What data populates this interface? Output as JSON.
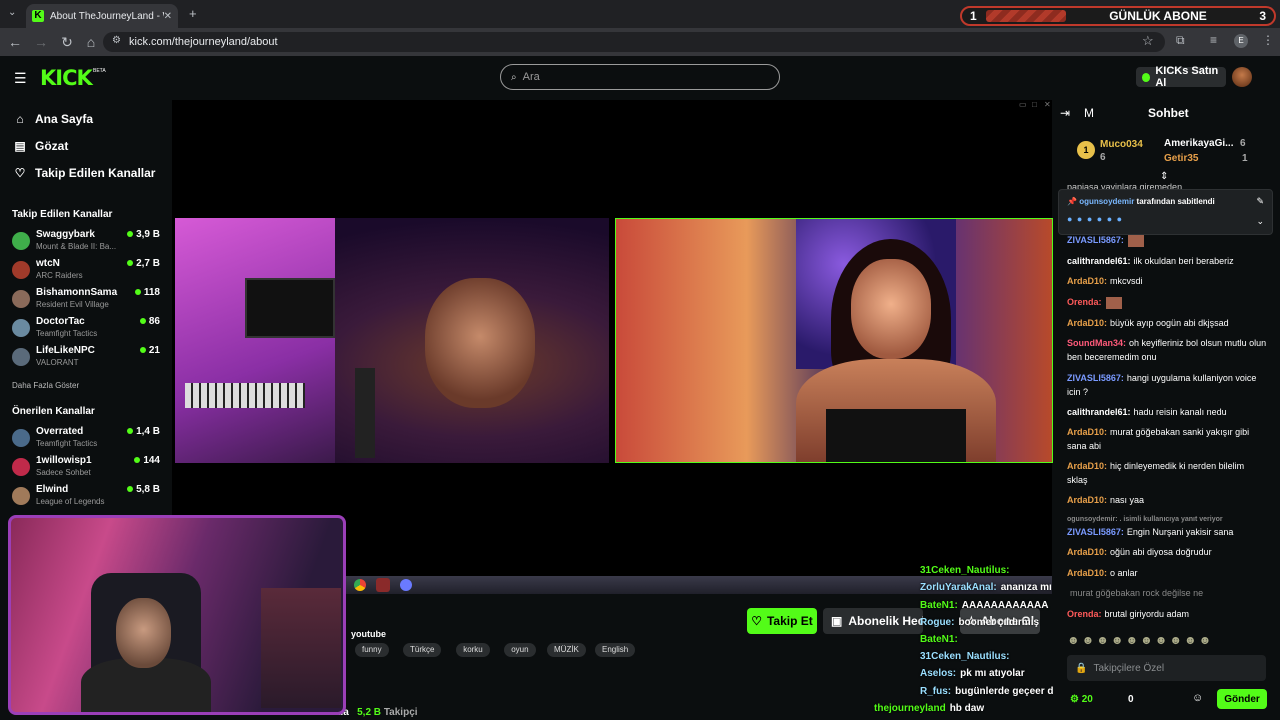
{
  "browser": {
    "tab_title": "About TheJourneyLand - W",
    "url": "kick.com/thejourneyland/about"
  },
  "sub_goal": {
    "left": "1",
    "label": "GÜNLÜK ABONE",
    "right": "3"
  },
  "header": {
    "logo": "KICK",
    "beta": "BETA",
    "search_placeholder": "Ara",
    "kicks_button": "KICKs Satın Al"
  },
  "sidebar": {
    "nav": [
      {
        "label": "Ana Sayfa",
        "icon": "home-icon"
      },
      {
        "label": "Gözat",
        "icon": "browse-icon"
      },
      {
        "label": "Takip Edilen Kanallar",
        "icon": "heart-icon"
      }
    ],
    "followed_title": "Takip Edilen Kanallar",
    "followed": [
      {
        "name": "Swaggybark",
        "game": "Mount & Blade II: Ba...",
        "viewers": "3,9 B",
        "color": "#3fae4a"
      },
      {
        "name": "wtcN",
        "game": "ARC Raiders",
        "viewers": "2,7 B",
        "color": "#a03a2a"
      },
      {
        "name": "BishamonnSama",
        "game": "Resident Evil Village",
        "viewers": "118",
        "color": "#8a6a5a"
      },
      {
        "name": "DoctorTac",
        "game": "Teamfight Tactics",
        "viewers": "86",
        "color": "#6a8aa0"
      },
      {
        "name": "LifeLikeNPC",
        "game": "VALORANT",
        "viewers": "21",
        "color": "#5a6a7a"
      }
    ],
    "show_more": "Daha Fazla Göster",
    "recommended_title": "Önerilen Kanallar",
    "recommended": [
      {
        "name": "Overrated",
        "game": "Teamfight Tactics",
        "viewers": "1,4 B",
        "color": "#4a6a8a"
      },
      {
        "name": "1willowisp1",
        "game": "Sadece Sohbet",
        "viewers": "144",
        "color": "#c02a4a"
      },
      {
        "name": "Elwind",
        "game": "League of Legends",
        "viewers": "5,8 B",
        "color": "#a07a5a"
      }
    ]
  },
  "channel": {
    "follow_button": "Takip Et",
    "sub_gift_button": "Abonelik Hediye Et",
    "sub_button": "Abone Ol",
    "category": "youtube",
    "tags": [
      "funny",
      "Türkçe",
      "korku",
      "oyun",
      "MÜZİK",
      "English"
    ],
    "name_partial": "nda",
    "followers_count": "5,2 B",
    "followers_label": "Takipçi"
  },
  "overlay_chat": [
    {
      "user": "31Ceken_Nautilus:",
      "text": ""
    },
    {
      "user": "ZorluYarakAnal:",
      "text": "ananıza mı sövdü orospu evlatları"
    },
    {
      "user": "BateN1:",
      "text": "AAAAAAAAAAAA"
    },
    {
      "user": "Rogue:",
      "text": "boomer çıldırmış"
    },
    {
      "user": "BateN1:",
      "text": ""
    },
    {
      "user": "31Ceken_Nautilus:",
      "text": ""
    },
    {
      "user": "Aselos:",
      "text": "pk mı atıyolar"
    },
    {
      "user": "R_fus:",
      "text": "bugünlerde geçeer dayıı eve dönersem ziyafet çekerim obur gibi"
    },
    {
      "user": "thejourneyland",
      "text": "hb daw"
    }
  ],
  "chat": {
    "collapse_icon": "collapse-icon",
    "tab_m": "M",
    "title": "Sohbet",
    "leaderboard": [
      {
        "rank": "1",
        "name": "Muco034",
        "count": "6"
      },
      {
        "name": "AmerikayaGi...",
        "count": "6"
      },
      {
        "name": "Getir35",
        "count": "1"
      }
    ],
    "cut_message": "papiasa yayinlara giremeden",
    "pinned": {
      "user": "ogunsoydemir",
      "text": "tarafından sabitlendi"
    },
    "messages": [
      {
        "user": "ZIVASLI5867:",
        "text": "",
        "color": "#7a9aff"
      },
      {
        "user": "calithrandel61:",
        "text": "ilk okuldan beri beraberiz",
        "color": "#ffffff"
      },
      {
        "user": "ArdaD10:",
        "text": "mkcvsdi",
        "color": "#e8a04a"
      },
      {
        "user": "Orenda:",
        "text": "",
        "color": "#ff5a5a"
      },
      {
        "user": "ArdaD10:",
        "text": "büyük ayıp oogün abi dkjşsad",
        "color": "#e8a04a"
      },
      {
        "user": "SoundMan34:",
        "text": "oh keyifleriniz bol olsun mutlu olun ben beceremedim onu",
        "color": "#ff5a7a"
      },
      {
        "user": "ZIVASLI5867:",
        "text": "hangi uygulama kullaniyon voice icin ?",
        "color": "#7a9aff"
      },
      {
        "user": "calithrandel61:",
        "text": "hadu reisin kanalı nedu",
        "color": "#ffffff"
      },
      {
        "user": "ArdaD10:",
        "text": "murat göğebakan sanki yakışır gibi sana abi",
        "color": "#e8a04a"
      },
      {
        "user": "ArdaD10:",
        "text": "hiç dinleyemedik ki nerden bilelim sklaş",
        "color": "#e8a04a"
      },
      {
        "user": "ArdaD10:",
        "text": "nası yaa",
        "color": "#e8a04a"
      },
      {
        "user": "ogunsoydemir: . isimli kullanıcıya yanıt veriyor",
        "text": "",
        "color": "#888888"
      },
      {
        "user": "ZIVASLI5867:",
        "text": "Engin Nurşani yakisir sana",
        "color": "#7a9aff"
      },
      {
        "user": "ArdaD10:",
        "text": "oğün abi diyosa doğrudur",
        "color": "#e8a04a"
      },
      {
        "user": "ArdaD10:",
        "text": "o anlar",
        "color": "#e8a04a"
      },
      {
        "user": "",
        "text": "murat göğebakan rock değilse ne",
        "color": "#888888"
      },
      {
        "user": "Orenda:",
        "text": "brutal giriyordu adam",
        "color": "#ff5a5a"
      }
    ],
    "input_placeholder": "Takipçilere Özel",
    "points": "20",
    "zero": "0",
    "send": "Gönder"
  }
}
